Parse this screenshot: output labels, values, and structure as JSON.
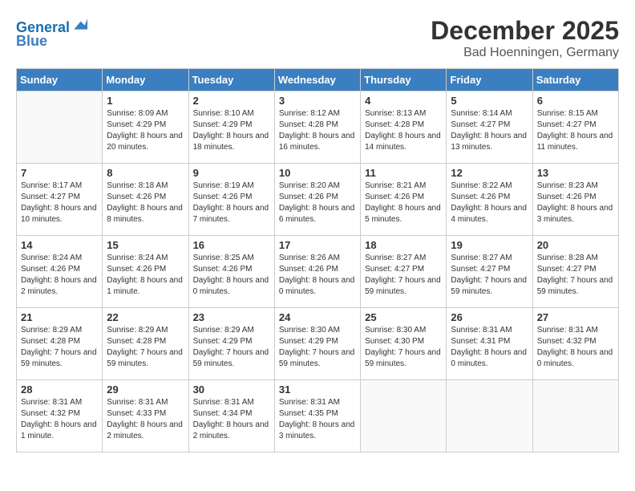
{
  "logo": {
    "line1": "General",
    "line2": "Blue"
  },
  "title": "December 2025",
  "location": "Bad Hoenningen, Germany",
  "days_of_week": [
    "Sunday",
    "Monday",
    "Tuesday",
    "Wednesday",
    "Thursday",
    "Friday",
    "Saturday"
  ],
  "weeks": [
    [
      {
        "day": "",
        "sunrise": "",
        "sunset": "",
        "daylight": ""
      },
      {
        "day": "1",
        "sunrise": "Sunrise: 8:09 AM",
        "sunset": "Sunset: 4:29 PM",
        "daylight": "Daylight: 8 hours and 20 minutes."
      },
      {
        "day": "2",
        "sunrise": "Sunrise: 8:10 AM",
        "sunset": "Sunset: 4:29 PM",
        "daylight": "Daylight: 8 hours and 18 minutes."
      },
      {
        "day": "3",
        "sunrise": "Sunrise: 8:12 AM",
        "sunset": "Sunset: 4:28 PM",
        "daylight": "Daylight: 8 hours and 16 minutes."
      },
      {
        "day": "4",
        "sunrise": "Sunrise: 8:13 AM",
        "sunset": "Sunset: 4:28 PM",
        "daylight": "Daylight: 8 hours and 14 minutes."
      },
      {
        "day": "5",
        "sunrise": "Sunrise: 8:14 AM",
        "sunset": "Sunset: 4:27 PM",
        "daylight": "Daylight: 8 hours and 13 minutes."
      },
      {
        "day": "6",
        "sunrise": "Sunrise: 8:15 AM",
        "sunset": "Sunset: 4:27 PM",
        "daylight": "Daylight: 8 hours and 11 minutes."
      }
    ],
    [
      {
        "day": "7",
        "sunrise": "Sunrise: 8:17 AM",
        "sunset": "Sunset: 4:27 PM",
        "daylight": "Daylight: 8 hours and 10 minutes."
      },
      {
        "day": "8",
        "sunrise": "Sunrise: 8:18 AM",
        "sunset": "Sunset: 4:26 PM",
        "daylight": "Daylight: 8 hours and 8 minutes."
      },
      {
        "day": "9",
        "sunrise": "Sunrise: 8:19 AM",
        "sunset": "Sunset: 4:26 PM",
        "daylight": "Daylight: 8 hours and 7 minutes."
      },
      {
        "day": "10",
        "sunrise": "Sunrise: 8:20 AM",
        "sunset": "Sunset: 4:26 PM",
        "daylight": "Daylight: 8 hours and 6 minutes."
      },
      {
        "day": "11",
        "sunrise": "Sunrise: 8:21 AM",
        "sunset": "Sunset: 4:26 PM",
        "daylight": "Daylight: 8 hours and 5 minutes."
      },
      {
        "day": "12",
        "sunrise": "Sunrise: 8:22 AM",
        "sunset": "Sunset: 4:26 PM",
        "daylight": "Daylight: 8 hours and 4 minutes."
      },
      {
        "day": "13",
        "sunrise": "Sunrise: 8:23 AM",
        "sunset": "Sunset: 4:26 PM",
        "daylight": "Daylight: 8 hours and 3 minutes."
      }
    ],
    [
      {
        "day": "14",
        "sunrise": "Sunrise: 8:24 AM",
        "sunset": "Sunset: 4:26 PM",
        "daylight": "Daylight: 8 hours and 2 minutes."
      },
      {
        "day": "15",
        "sunrise": "Sunrise: 8:24 AM",
        "sunset": "Sunset: 4:26 PM",
        "daylight": "Daylight: 8 hours and 1 minute."
      },
      {
        "day": "16",
        "sunrise": "Sunrise: 8:25 AM",
        "sunset": "Sunset: 4:26 PM",
        "daylight": "Daylight: 8 hours and 0 minutes."
      },
      {
        "day": "17",
        "sunrise": "Sunrise: 8:26 AM",
        "sunset": "Sunset: 4:26 PM",
        "daylight": "Daylight: 8 hours and 0 minutes."
      },
      {
        "day": "18",
        "sunrise": "Sunrise: 8:27 AM",
        "sunset": "Sunset: 4:27 PM",
        "daylight": "Daylight: 7 hours and 59 minutes."
      },
      {
        "day": "19",
        "sunrise": "Sunrise: 8:27 AM",
        "sunset": "Sunset: 4:27 PM",
        "daylight": "Daylight: 7 hours and 59 minutes."
      },
      {
        "day": "20",
        "sunrise": "Sunrise: 8:28 AM",
        "sunset": "Sunset: 4:27 PM",
        "daylight": "Daylight: 7 hours and 59 minutes."
      }
    ],
    [
      {
        "day": "21",
        "sunrise": "Sunrise: 8:29 AM",
        "sunset": "Sunset: 4:28 PM",
        "daylight": "Daylight: 7 hours and 59 minutes."
      },
      {
        "day": "22",
        "sunrise": "Sunrise: 8:29 AM",
        "sunset": "Sunset: 4:28 PM",
        "daylight": "Daylight: 7 hours and 59 minutes."
      },
      {
        "day": "23",
        "sunrise": "Sunrise: 8:29 AM",
        "sunset": "Sunset: 4:29 PM",
        "daylight": "Daylight: 7 hours and 59 minutes."
      },
      {
        "day": "24",
        "sunrise": "Sunrise: 8:30 AM",
        "sunset": "Sunset: 4:29 PM",
        "daylight": "Daylight: 7 hours and 59 minutes."
      },
      {
        "day": "25",
        "sunrise": "Sunrise: 8:30 AM",
        "sunset": "Sunset: 4:30 PM",
        "daylight": "Daylight: 7 hours and 59 minutes."
      },
      {
        "day": "26",
        "sunrise": "Sunrise: 8:31 AM",
        "sunset": "Sunset: 4:31 PM",
        "daylight": "Daylight: 8 hours and 0 minutes."
      },
      {
        "day": "27",
        "sunrise": "Sunrise: 8:31 AM",
        "sunset": "Sunset: 4:32 PM",
        "daylight": "Daylight: 8 hours and 0 minutes."
      }
    ],
    [
      {
        "day": "28",
        "sunrise": "Sunrise: 8:31 AM",
        "sunset": "Sunset: 4:32 PM",
        "daylight": "Daylight: 8 hours and 1 minute."
      },
      {
        "day": "29",
        "sunrise": "Sunrise: 8:31 AM",
        "sunset": "Sunset: 4:33 PM",
        "daylight": "Daylight: 8 hours and 2 minutes."
      },
      {
        "day": "30",
        "sunrise": "Sunrise: 8:31 AM",
        "sunset": "Sunset: 4:34 PM",
        "daylight": "Daylight: 8 hours and 2 minutes."
      },
      {
        "day": "31",
        "sunrise": "Sunrise: 8:31 AM",
        "sunset": "Sunset: 4:35 PM",
        "daylight": "Daylight: 8 hours and 3 minutes."
      },
      {
        "day": "",
        "sunrise": "",
        "sunset": "",
        "daylight": ""
      },
      {
        "day": "",
        "sunrise": "",
        "sunset": "",
        "daylight": ""
      },
      {
        "day": "",
        "sunrise": "",
        "sunset": "",
        "daylight": ""
      }
    ]
  ]
}
